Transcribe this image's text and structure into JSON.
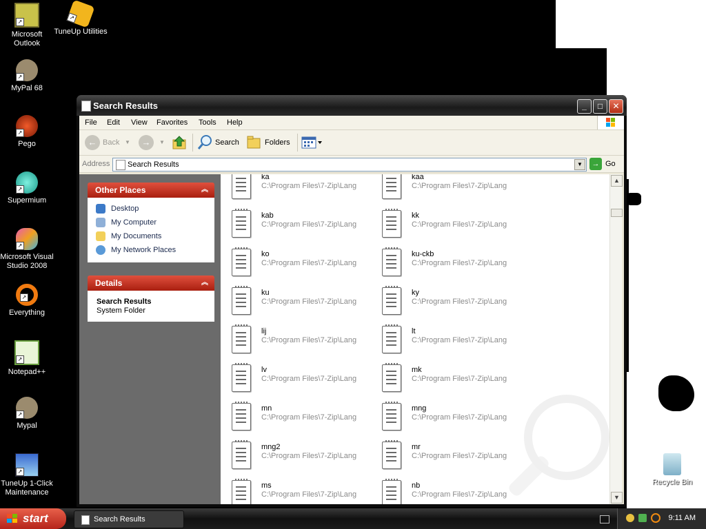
{
  "desktop": {
    "icons": [
      {
        "label": "Microsoft Outlook",
        "icon": "outlook-icon"
      },
      {
        "label": "TuneUp Utilities",
        "icon": "tuneup-icon"
      },
      {
        "label": "MyPal 68",
        "icon": "mypal-icon"
      },
      {
        "label": "Pego",
        "icon": "pego-icon"
      },
      {
        "label": "Supermium",
        "icon": "supermium-icon"
      },
      {
        "label": "Microsoft Visual Studio 2008",
        "icon": "visual-studio-icon"
      },
      {
        "label": "Everything",
        "icon": "everything-icon"
      },
      {
        "label": "Notepad++",
        "icon": "notepadpp-icon"
      },
      {
        "label": "Mypal",
        "icon": "mypal-icon"
      },
      {
        "label": "TuneUp 1-Click Maintenance",
        "icon": "tuneup-maintenance-icon"
      }
    ],
    "recycle_bin": "Recycle Bin"
  },
  "window": {
    "title": "Search Results",
    "menu": [
      "File",
      "Edit",
      "View",
      "Favorites",
      "Tools",
      "Help"
    ],
    "toolbar": {
      "back": "Back",
      "search": "Search",
      "folders": "Folders"
    },
    "address": {
      "label": "Address",
      "value": "Search Results",
      "go": "Go"
    }
  },
  "taskpane": {
    "other_places": {
      "title": "Other Places",
      "items": [
        "Desktop",
        "My Computer",
        "My Documents",
        "My Network Places"
      ]
    },
    "details": {
      "title": "Details",
      "name": "Search Results",
      "type": "System Folder"
    }
  },
  "files": [
    {
      "name": "ka",
      "path": "C:\\Program Files\\7-Zip\\Lang"
    },
    {
      "name": "kaa",
      "path": "C:\\Program Files\\7-Zip\\Lang"
    },
    {
      "name": "kab",
      "path": "C:\\Program Files\\7-Zip\\Lang"
    },
    {
      "name": "kk",
      "path": "C:\\Program Files\\7-Zip\\Lang"
    },
    {
      "name": "ko",
      "path": "C:\\Program Files\\7-Zip\\Lang"
    },
    {
      "name": "ku-ckb",
      "path": "C:\\Program Files\\7-Zip\\Lang"
    },
    {
      "name": "ku",
      "path": "C:\\Program Files\\7-Zip\\Lang"
    },
    {
      "name": "ky",
      "path": "C:\\Program Files\\7-Zip\\Lang"
    },
    {
      "name": "lij",
      "path": "C:\\Program Files\\7-Zip\\Lang"
    },
    {
      "name": "lt",
      "path": "C:\\Program Files\\7-Zip\\Lang"
    },
    {
      "name": "lv",
      "path": "C:\\Program Files\\7-Zip\\Lang"
    },
    {
      "name": "mk",
      "path": "C:\\Program Files\\7-Zip\\Lang"
    },
    {
      "name": "mn",
      "path": "C:\\Program Files\\7-Zip\\Lang"
    },
    {
      "name": "mng",
      "path": "C:\\Program Files\\7-Zip\\Lang"
    },
    {
      "name": "mng2",
      "path": "C:\\Program Files\\7-Zip\\Lang"
    },
    {
      "name": "mr",
      "path": "C:\\Program Files\\7-Zip\\Lang"
    },
    {
      "name": "ms",
      "path": "C:\\Program Files\\7-Zip\\Lang"
    },
    {
      "name": "nb",
      "path": "C:\\Program Files\\7-Zip\\Lang"
    }
  ],
  "taskbar": {
    "start": "start",
    "task": "Search Results",
    "clock": "9:11 AM"
  },
  "colors": {
    "panel_header": "#c0301c",
    "start_button": "#c8392a",
    "taskpane_bg": "#6b6b6b"
  }
}
